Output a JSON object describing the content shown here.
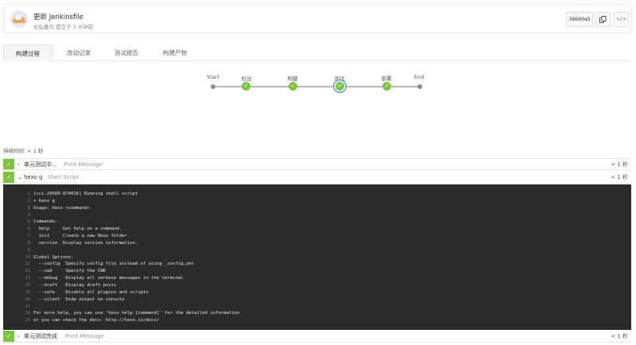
{
  "commit": {
    "title": "更新 Jenkinsfile",
    "subtitle": "长弘嘉司 提交于 3 分钟前",
    "sha": "38689a5",
    "copy_icon": "copy-icon",
    "code_icon_text": "</>"
  },
  "tabs": [
    {
      "label": "构建过程",
      "active": true
    },
    {
      "label": "改动记录",
      "active": false
    },
    {
      "label": "测试报告",
      "active": false
    },
    {
      "label": "构建产物",
      "active": false
    }
  ],
  "stages": [
    {
      "label": "Start",
      "status": "start"
    },
    {
      "label": "检出",
      "status": "success"
    },
    {
      "label": "构建",
      "status": "success"
    },
    {
      "label": "测试",
      "status": "success",
      "selected": true
    },
    {
      "label": "部署",
      "status": "success"
    },
    {
      "label": "End",
      "status": "end"
    }
  ],
  "duration": "持续时间: < 1 秒",
  "steps": [
    {
      "name": "单元测试中...",
      "desc": "Print Message",
      "time": "< 1 秒",
      "expanded": false
    },
    {
      "name": "hexo g",
      "desc": "Shell Script",
      "time": "< 1 秒",
      "expanded": true
    },
    {
      "name": "单元测试完成",
      "desc": "Print Message",
      "time": "< 1 秒",
      "expanded": false
    }
  ],
  "console_lines": [
    "[cci-29569-874016] Running shell script",
    "+ hexo g",
    "Usage: hexo <command>",
    "",
    "Commands:",
    "  help     Get help on a command.",
    "  init     Create a new Hexo folder.",
    "  version  Display version information.",
    "",
    "Global Options:",
    "  --config  Specify config file instead of using _config.yml",
    "  --cwd     Specify the CWD",
    "  --debug   Display all verbose messages in the terminal",
    "  --draft   Display draft posts",
    "  --safe    Disable all plugins and scripts",
    "  --silent  Hide output on console",
    "",
    "For more help, you can use 'hexo help [command]' for the detailed information",
    "or you can check the docs: http://hexo.io/docs/"
  ],
  "colors": {
    "success": "#7cc541",
    "console_bg": "#2b2b2b",
    "selected_ring": "#5b9bd5"
  }
}
